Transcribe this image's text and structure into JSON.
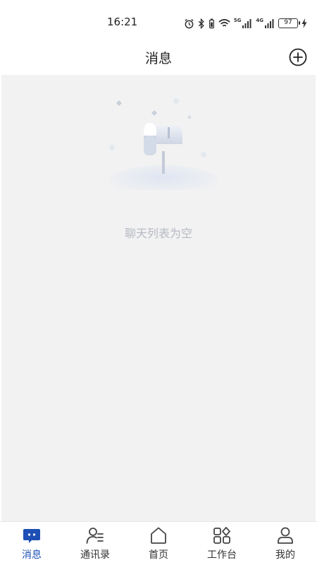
{
  "status_bar": {
    "time": "16:21",
    "network_1": "5G",
    "network_2": "4G",
    "battery": "97"
  },
  "header": {
    "title": "消息",
    "add_icon": "plus-circle-icon"
  },
  "main": {
    "empty_text": "聊天列表为空",
    "illustration": "mailbox-icon"
  },
  "tab_bar": {
    "active_color": "#1d4fb5",
    "tabs": [
      {
        "label": "消息",
        "icon": "chat-icon",
        "active": true
      },
      {
        "label": "通讯录",
        "icon": "contacts-icon",
        "active": false
      },
      {
        "label": "首页",
        "icon": "home-icon",
        "active": false
      },
      {
        "label": "工作台",
        "icon": "workbench-icon",
        "active": false
      },
      {
        "label": "我的",
        "icon": "profile-icon",
        "active": false
      }
    ]
  }
}
